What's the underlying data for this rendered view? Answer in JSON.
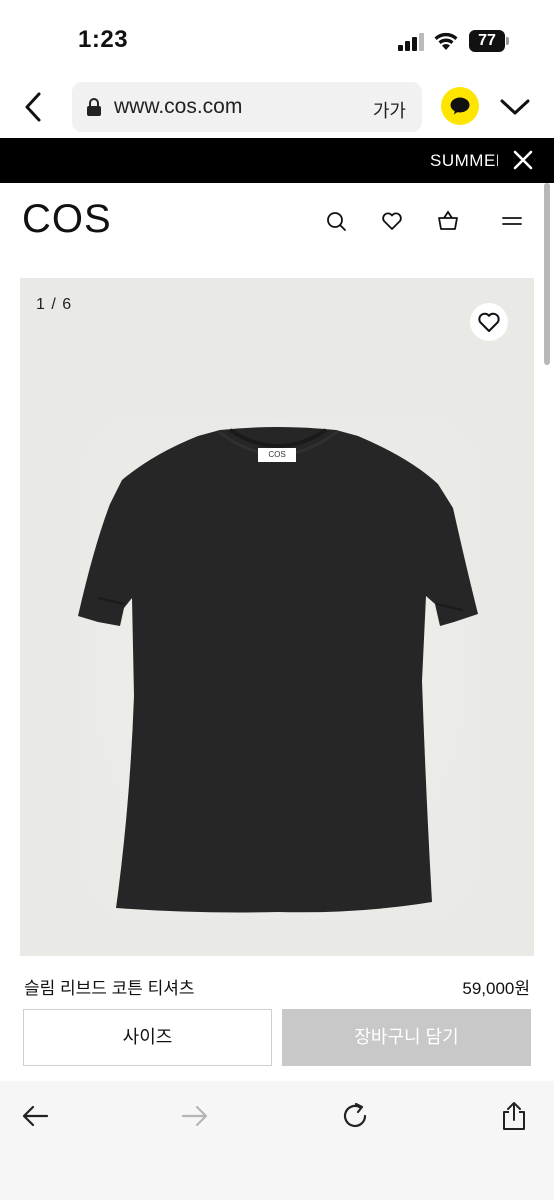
{
  "status_bar": {
    "time": "1:23",
    "battery": "77"
  },
  "browser": {
    "url": "www.cos.com",
    "text_size_label": "가가",
    "icons": [
      "back-chevron-icon",
      "lock-icon",
      "kakaotalk-icon",
      "chevron-down-icon"
    ]
  },
  "promo": {
    "text": "SUMMER"
  },
  "site": {
    "logo": "COS",
    "icons": [
      "search-icon",
      "heart-icon",
      "bag-icon",
      "menu-icon"
    ]
  },
  "gallery": {
    "counter": "1 / 6",
    "garment_label": "COS"
  },
  "product": {
    "name": "슬림 리브드 코튼 티셔츠",
    "price": "59,000원",
    "size_button": "사이즈",
    "add_to_cart_button": "장바구니 담기"
  },
  "toolbar": {
    "icons": [
      "back-arrow-icon",
      "forward-arrow-icon",
      "reload-icon",
      "share-icon"
    ]
  },
  "colors": {
    "promo_bg": "#000000",
    "kakao_yellow": "#FEE500",
    "cart_button_disabled": "#C8C8C8",
    "gallery_bg": "#E9E9E6"
  }
}
